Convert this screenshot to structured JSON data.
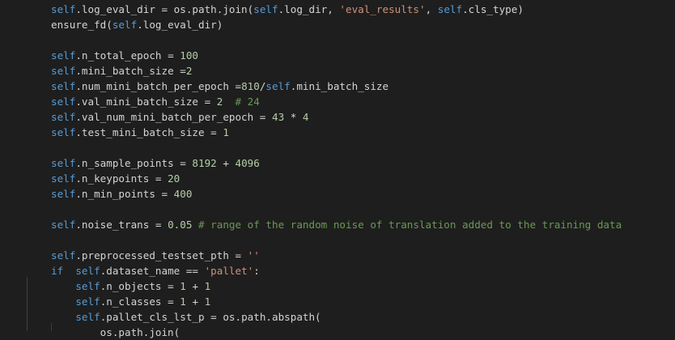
{
  "editor": {
    "colors": {
      "background": "#1e1e1e",
      "self_keyword": "#569cd6",
      "string": "#ce9178",
      "number": "#b5cea8",
      "comment": "#6a9955",
      "plain": "#d4d4d4"
    },
    "lines": [
      [
        {
          "t": "self",
          "k": "self"
        },
        {
          "t": ".log_eval_dir = os.path.join(",
          "k": "pl"
        },
        {
          "t": "self",
          "k": "self"
        },
        {
          "t": ".log_dir, ",
          "k": "pl"
        },
        {
          "t": "'eval_results'",
          "k": "str"
        },
        {
          "t": ", ",
          "k": "pl"
        },
        {
          "t": "self",
          "k": "self"
        },
        {
          "t": ".cls_type)",
          "k": "pl"
        }
      ],
      [
        {
          "t": "ensure_fd(",
          "k": "pl"
        },
        {
          "t": "self",
          "k": "self"
        },
        {
          "t": ".log_eval_dir)",
          "k": "pl"
        }
      ],
      [],
      [
        {
          "t": "self",
          "k": "self"
        },
        {
          "t": ".n_total_epoch = ",
          "k": "pl"
        },
        {
          "t": "100",
          "k": "num"
        }
      ],
      [
        {
          "t": "self",
          "k": "self"
        },
        {
          "t": ".mini_batch_size =",
          "k": "pl"
        },
        {
          "t": "2",
          "k": "num"
        }
      ],
      [
        {
          "t": "self",
          "k": "self"
        },
        {
          "t": ".num_mini_batch_per_epoch =",
          "k": "pl"
        },
        {
          "t": "810",
          "k": "num"
        },
        {
          "t": "/",
          "k": "pl"
        },
        {
          "t": "self",
          "k": "self"
        },
        {
          "t": ".mini_batch_size",
          "k": "pl"
        }
      ],
      [
        {
          "t": "self",
          "k": "self"
        },
        {
          "t": ".val_mini_batch_size = ",
          "k": "pl"
        },
        {
          "t": "2",
          "k": "num"
        },
        {
          "t": "  ",
          "k": "pl"
        },
        {
          "t": "# 24",
          "k": "cm"
        }
      ],
      [
        {
          "t": "self",
          "k": "self"
        },
        {
          "t": ".val_num_mini_batch_per_epoch = ",
          "k": "pl"
        },
        {
          "t": "43",
          "k": "num"
        },
        {
          "t": " * ",
          "k": "pl"
        },
        {
          "t": "4",
          "k": "num"
        }
      ],
      [
        {
          "t": "self",
          "k": "self"
        },
        {
          "t": ".test_mini_batch_size = ",
          "k": "pl"
        },
        {
          "t": "1",
          "k": "num"
        }
      ],
      [],
      [
        {
          "t": "self",
          "k": "self"
        },
        {
          "t": ".n_sample_points = ",
          "k": "pl"
        },
        {
          "t": "8192",
          "k": "num"
        },
        {
          "t": " + ",
          "k": "pl"
        },
        {
          "t": "4096",
          "k": "num"
        }
      ],
      [
        {
          "t": "self",
          "k": "self"
        },
        {
          "t": ".n_keypoints = ",
          "k": "pl"
        },
        {
          "t": "20",
          "k": "num"
        }
      ],
      [
        {
          "t": "self",
          "k": "self"
        },
        {
          "t": ".n_min_points = ",
          "k": "pl"
        },
        {
          "t": "400",
          "k": "num"
        }
      ],
      [],
      [
        {
          "t": "self",
          "k": "self"
        },
        {
          "t": ".noise_trans = ",
          "k": "pl"
        },
        {
          "t": "0.05",
          "k": "num"
        },
        {
          "t": " ",
          "k": "pl"
        },
        {
          "t": "# range of the random noise of translation added to the training data",
          "k": "cm"
        }
      ],
      [],
      [
        {
          "t": "self",
          "k": "self"
        },
        {
          "t": ".preprocessed_testset_pth = ",
          "k": "pl"
        },
        {
          "t": "''",
          "k": "str"
        }
      ],
      [
        {
          "t": "if",
          "k": "kw"
        },
        {
          "t": "  ",
          "k": "pl"
        },
        {
          "t": "self",
          "k": "self"
        },
        {
          "t": ".dataset_name == ",
          "k": "pl"
        },
        {
          "t": "'pallet'",
          "k": "str"
        },
        {
          "t": ":",
          "k": "pl"
        }
      ],
      [
        {
          "t": "    ",
          "k": "pl"
        },
        {
          "t": "self",
          "k": "self"
        },
        {
          "t": ".n_objects = ",
          "k": "pl"
        },
        {
          "t": "1",
          "k": "num"
        },
        {
          "t": " + ",
          "k": "pl"
        },
        {
          "t": "1",
          "k": "num"
        }
      ],
      [
        {
          "t": "    ",
          "k": "pl"
        },
        {
          "t": "self",
          "k": "self"
        },
        {
          "t": ".n_classes = ",
          "k": "pl"
        },
        {
          "t": "1",
          "k": "num"
        },
        {
          "t": " + ",
          "k": "pl"
        },
        {
          "t": "1",
          "k": "num"
        }
      ],
      [
        {
          "t": "    ",
          "k": "pl"
        },
        {
          "t": "self",
          "k": "self"
        },
        {
          "t": ".pallet_cls_lst_p = os.path.abspath(",
          "k": "pl"
        }
      ],
      [
        {
          "t": "        os.path.join(",
          "k": "pl"
        }
      ]
    ]
  }
}
